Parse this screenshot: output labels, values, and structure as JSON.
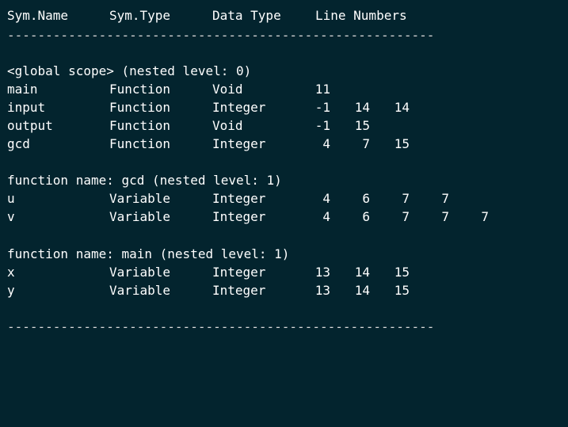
{
  "header": {
    "columns": [
      "Sym.Name",
      "Sym.Type",
      "Data Type",
      "Line Numbers"
    ]
  },
  "rule": "--------------------------------------------------------",
  "sections": [
    {
      "title": "<global scope> (nested level: 0)",
      "rows": [
        {
          "name": "main",
          "type": "Function",
          "data_type": "Void",
          "lines": [
            "11"
          ]
        },
        {
          "name": "input",
          "type": "Function",
          "data_type": "Integer",
          "lines": [
            "-1",
            "14",
            "14"
          ]
        },
        {
          "name": "output",
          "type": "Function",
          "data_type": "Void",
          "lines": [
            "-1",
            "15"
          ]
        },
        {
          "name": "gcd",
          "type": "Function",
          "data_type": "Integer",
          "lines": [
            "4",
            "7",
            "15"
          ]
        }
      ]
    },
    {
      "title": "function name: gcd (nested level: 1)",
      "rows": [
        {
          "name": "u",
          "type": "Variable",
          "data_type": "Integer",
          "lines": [
            "4",
            "6",
            "7",
            "7"
          ]
        },
        {
          "name": "v",
          "type": "Variable",
          "data_type": "Integer",
          "lines": [
            "4",
            "6",
            "7",
            "7",
            "7"
          ]
        }
      ]
    },
    {
      "title": "function name: main (nested level: 1)",
      "rows": [
        {
          "name": "x",
          "type": "Variable",
          "data_type": "Integer",
          "lines": [
            "13",
            "14",
            "15"
          ]
        },
        {
          "name": "y",
          "type": "Variable",
          "data_type": "Integer",
          "lines": [
            "13",
            "14",
            "15"
          ]
        }
      ]
    }
  ]
}
